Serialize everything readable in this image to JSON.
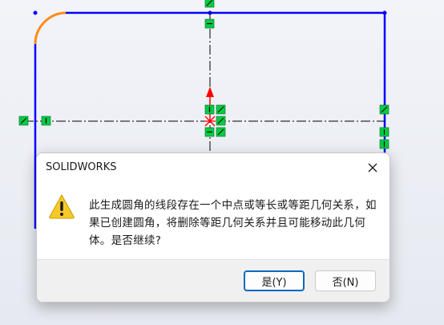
{
  "dialog": {
    "title": "SOLIDWORKS",
    "message": "此生成圆角的线段存在一个中点或等长或等距几何关系，如果已创建圆角，将删除等距几何关系并且可能移动此几何体。是否继续?",
    "buttons": {
      "yes": "是(Y)",
      "no": "否(N)"
    },
    "icon": "warning-icon",
    "close_icon": "close-icon"
  },
  "sketch": {
    "line_color": "#0000ff",
    "fillet_color": "#ff8c1a",
    "relation_color": "#00cc44",
    "origin_color": "#ff0000",
    "centerline_color": "#000000"
  }
}
